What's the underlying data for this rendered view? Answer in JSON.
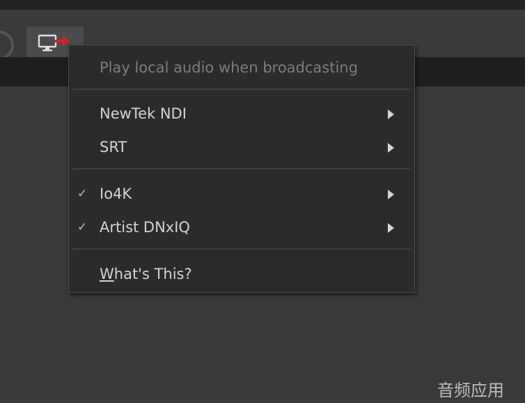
{
  "toolbar": {
    "broadcast_icon": "monitor-broadcast-icon",
    "record_icon": "circle-icon"
  },
  "menu": {
    "items": [
      {
        "label": "Play local audio when broadcasting",
        "enabled": false
      },
      {
        "label": "NewTek NDI",
        "submenu": true
      },
      {
        "label": "SRT",
        "submenu": true
      },
      {
        "label": "Io4K",
        "checked": true,
        "submenu": true
      },
      {
        "label": "Artist DNxIQ",
        "checked": true,
        "submenu": true
      }
    ],
    "whats_this": {
      "mnemonic": "W",
      "rest": "hat's This?"
    },
    "check_glyph": "✓"
  },
  "watermark": "音频应用"
}
